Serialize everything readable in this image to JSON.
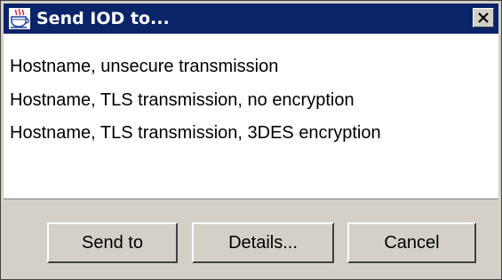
{
  "window": {
    "title": "Send IOD to...",
    "icon": "java-coffee-cup-icon",
    "close_icon": "close-x-icon",
    "colors": {
      "titlebar": "#0a246a",
      "face": "#d4d0c8",
      "list_bg": "#ffffff"
    }
  },
  "list": {
    "items": [
      "Hostname, unsecure transmission",
      "Hostname, TLS transmission, no encryption",
      "Hostname, TLS transmission, 3DES encryption"
    ]
  },
  "buttons": {
    "send_to": "Send to",
    "details": "Details...",
    "cancel": "Cancel"
  }
}
